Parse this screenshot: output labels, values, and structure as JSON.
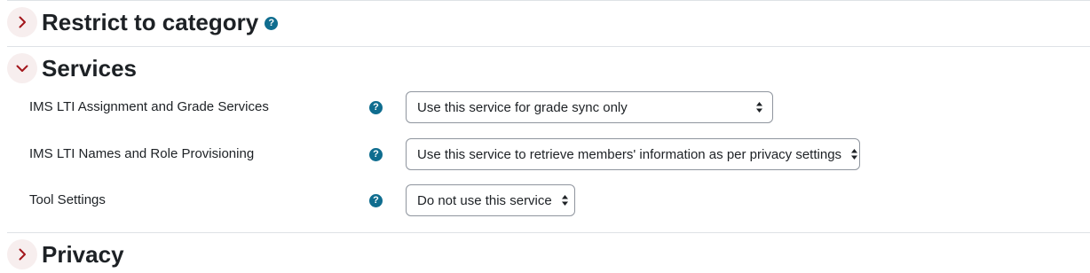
{
  "sections": {
    "restrict": {
      "title": "Restrict to category",
      "state": "collapsed",
      "help_icon": "question-icon"
    },
    "services": {
      "title": "Services",
      "state": "expanded",
      "fields": [
        {
          "label": "IMS LTI Assignment and Grade Services",
          "value": "Use this service for grade sync only",
          "help_icon": "question-icon"
        },
        {
          "label": "IMS LTI Names and Role Provisioning",
          "value": "Use this service to retrieve members' information as per privacy settings",
          "help_icon": "question-icon"
        },
        {
          "label": "Tool Settings",
          "value": "Do not use this service",
          "help_icon": "question-icon"
        }
      ]
    },
    "privacy": {
      "title": "Privacy",
      "state": "collapsed"
    }
  },
  "icons": {
    "collapsed": "chevron-right-icon",
    "expanded": "chevron-down-icon",
    "help": "?",
    "select": "sort-arrows-icon"
  },
  "colors": {
    "chevron": "#a3161b",
    "toggle_bg": "#f7eeee",
    "help_bg": "#0f6d8f",
    "select_border": "#8f959e",
    "divider": "#dee2e6",
    "text": "#1d2125"
  }
}
